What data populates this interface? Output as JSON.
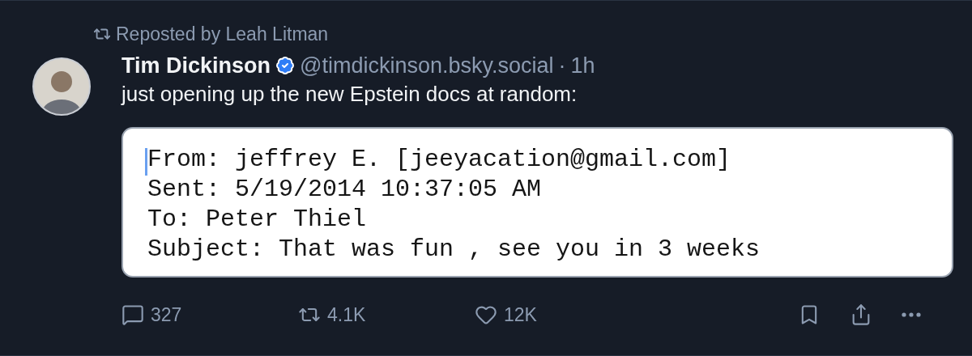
{
  "repost": {
    "label": "Reposted by Leah Litman"
  },
  "author": {
    "name": "Tim Dickinson",
    "verified": true,
    "handle": "@timdickinson.bsky.social",
    "separator": "·",
    "time": "1h"
  },
  "text": "just opening up the new Epstein docs at random:",
  "embed": {
    "lines": [
      "From: jeffrey E. [jeeyacation@gmail.com]",
      "Sent: 5/19/2014 10:37:05 AM",
      "To: Peter Thiel",
      "Subject: That was fun , see you in 3 weeks"
    ]
  },
  "actions": [
    {
      "kind": "reply",
      "count": "327"
    },
    {
      "kind": "repost",
      "count": "4.1K"
    },
    {
      "kind": "like",
      "count": "12K"
    },
    {
      "kind": "bookmark"
    },
    {
      "kind": "share"
    },
    {
      "kind": "more"
    }
  ]
}
